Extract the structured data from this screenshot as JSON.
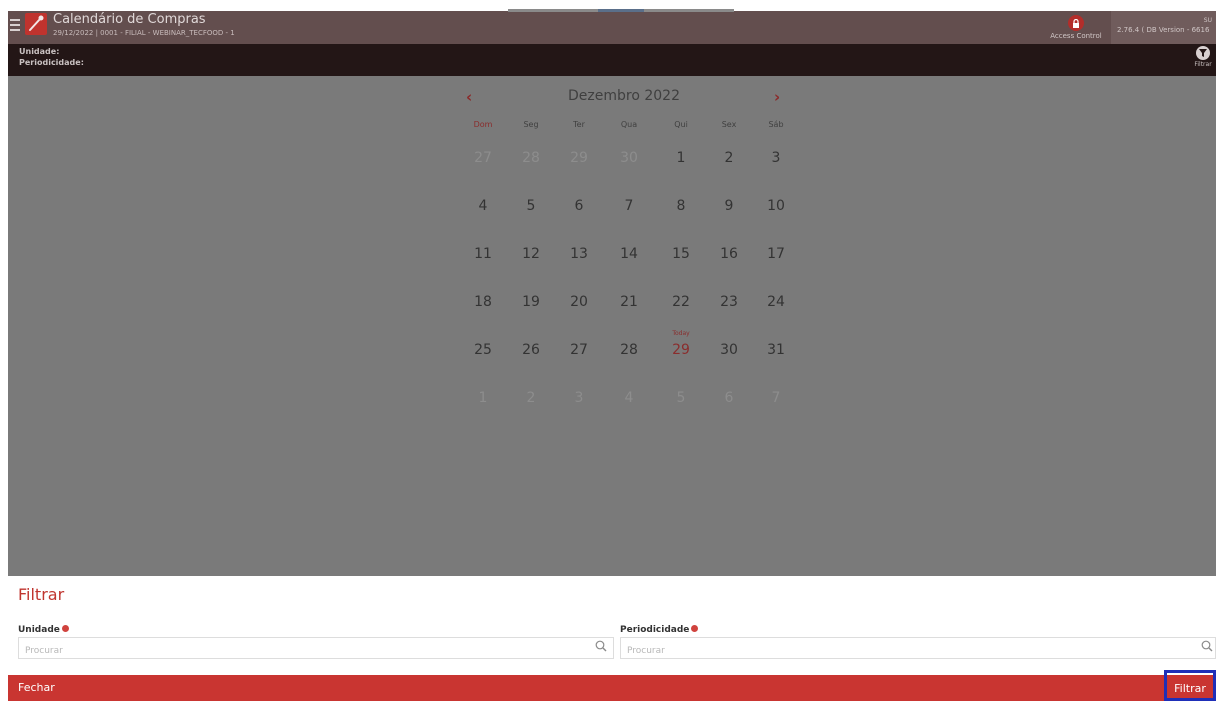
{
  "header": {
    "title": "Calendário de Compras",
    "subtitle": "29/12/2022 | 0001 - FILIAL - WEBINAR_TECFOOD - 1",
    "access_label": "Access Control",
    "user": "SU",
    "version": "2.76.4 ( DB Version - 6616"
  },
  "subheader": {
    "unidade_label": "Unidade:",
    "periodicidade_label": "Periodicidade:",
    "filter_label": "Filtrar"
  },
  "calendar": {
    "prev": "‹",
    "next": "›",
    "month": "Dezembro 2022",
    "weekdays": [
      "Dom",
      "Seg",
      "Ter",
      "Qua",
      "Qui",
      "Sex",
      "Sáb"
    ],
    "weeks": [
      [
        "27",
        "28",
        "29",
        "30",
        "1",
        "2",
        "3"
      ],
      [
        "4",
        "5",
        "6",
        "7",
        "8",
        "9",
        "10"
      ],
      [
        "11",
        "12",
        "13",
        "14",
        "15",
        "16",
        "17"
      ],
      [
        "18",
        "19",
        "20",
        "21",
        "22",
        "23",
        "24"
      ],
      [
        "25",
        "26",
        "27",
        "28",
        "29",
        "30",
        "31"
      ],
      [
        "1",
        "2",
        "3",
        "4",
        "5",
        "6",
        "7"
      ]
    ],
    "today_label": "Today",
    "today_value": "29",
    "other_month_days": "first row 27-30 and last row 1-7"
  },
  "filter_sheet": {
    "title": "Filtrar",
    "unidade": {
      "label": "Unidade",
      "placeholder": "Procurar",
      "value": ""
    },
    "periodicidade": {
      "label": "Periodicidade",
      "placeholder": "Procurar",
      "value": ""
    }
  },
  "footer": {
    "close_label": "Fechar",
    "filter_label": "Filtrar"
  },
  "colors": {
    "accent": "#c93531",
    "topbar": "#634e4e",
    "subbar": "#231616",
    "overlay": "#7a7a7a",
    "selection_outline": "#1f2fb8"
  }
}
